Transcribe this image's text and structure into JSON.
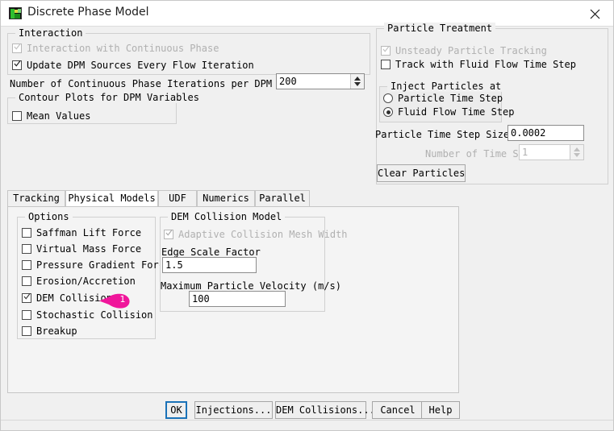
{
  "window": {
    "title": "Discrete Phase Model",
    "icon": "fluent-app-icon",
    "close_icon": "close-icon"
  },
  "interaction": {
    "legend": "Interaction",
    "interaction_with_continuous_phase": {
      "label": "Interaction with Continuous Phase",
      "checked": true,
      "disabled": true
    },
    "update_dpm_sources": {
      "label": "Update DPM Sources Every Flow Iteration",
      "checked": true,
      "disabled": false
    },
    "iterations_label": "Number of Continuous Phase Iterations per DPM Iteration",
    "iterations_value": "200"
  },
  "contour_plots": {
    "legend": "Contour Plots for DPM Variables",
    "mean_values": {
      "label": "Mean Values",
      "checked": false,
      "disabled": false
    }
  },
  "particle_treatment": {
    "legend": "Particle Treatment",
    "unsteady_particle_tracking": {
      "label": "Unsteady Particle Tracking",
      "checked": true,
      "disabled": true
    },
    "track_with_fluid_flow_time_step": {
      "label": "Track with Fluid Flow Time Step",
      "checked": false,
      "disabled": false
    },
    "inject_particles_at": {
      "legend": "Inject Particles at",
      "options": [
        {
          "label": "Particle Time Step",
          "selected": false
        },
        {
          "label": "Fluid Flow Time Step",
          "selected": true
        }
      ]
    },
    "particle_time_step_size_label": "Particle Time Step Size (s)",
    "particle_time_step_size_value": "0.0002",
    "number_of_time_steps_label": "Number of Time Steps",
    "number_of_time_steps_value": "1",
    "number_of_time_steps_disabled": true,
    "clear_particles_label": "Clear Particles"
  },
  "tabs": [
    {
      "label": "Tracking",
      "active": false
    },
    {
      "label": "Physical Models",
      "active": true
    },
    {
      "label": "UDF",
      "active": false
    },
    {
      "label": "Numerics",
      "active": false
    },
    {
      "label": "Parallel",
      "active": false
    }
  ],
  "options": {
    "legend": "Options",
    "items": [
      {
        "label": "Saffman Lift Force",
        "checked": false,
        "disabled": false
      },
      {
        "label": "Virtual Mass Force",
        "checked": false,
        "disabled": false
      },
      {
        "label": "Pressure Gradient Force",
        "checked": false,
        "disabled": false
      },
      {
        "label": "Erosion/Accretion",
        "checked": false,
        "disabled": false
      },
      {
        "label": "DEM Collision",
        "checked": true,
        "disabled": false
      },
      {
        "label": "Stochastic Collision",
        "checked": false,
        "disabled": false
      },
      {
        "label": "Breakup",
        "checked": false,
        "disabled": false
      }
    ]
  },
  "dem_collision_model": {
    "legend": "DEM Collision Model",
    "adaptive_collision_mesh_width": {
      "label": "Adaptive Collision Mesh Width",
      "checked": true,
      "disabled": true
    },
    "edge_scale_factor_label": "Edge Scale Factor",
    "edge_scale_factor_value": "1.5",
    "maximum_particle_velocity_label": "Maximum Particle Velocity (m/s)",
    "maximum_particle_velocity_value": "100"
  },
  "footer_buttons": [
    {
      "label": "OK",
      "focused": true
    },
    {
      "label": "Injections...",
      "focused": false
    },
    {
      "label": "DEM Collisions...",
      "focused": false
    },
    {
      "label": "Cancel",
      "focused": false
    },
    {
      "label": "Help",
      "focused": false
    }
  ],
  "annotation": {
    "marker_number": "1",
    "marker_color": "#f0169b"
  }
}
